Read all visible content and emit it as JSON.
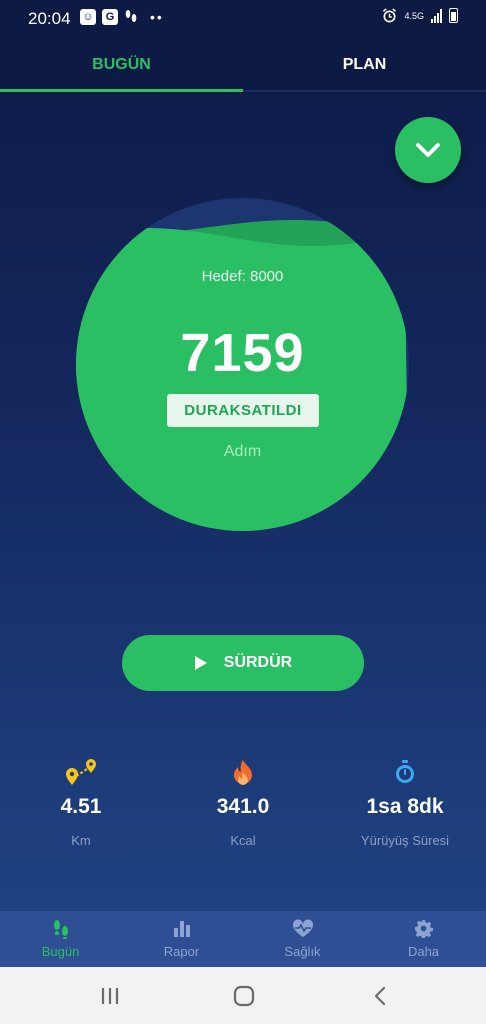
{
  "status_bar": {
    "time": "20:04",
    "network": "4.5G"
  },
  "tabs": [
    {
      "label": "BUGÜN"
    },
    {
      "label": "PLAN"
    }
  ],
  "today": {
    "goal": "Hedef: 8000",
    "steps": "7159",
    "goal_progress": 0.895,
    "state": "DURAKSATILDI",
    "unit": "Adım"
  },
  "resume_button": {
    "label": "SÜRDÜR"
  },
  "stats": [
    {
      "icon": "location-route-icon",
      "value": "4.51",
      "label": "Km"
    },
    {
      "icon": "fire-icon",
      "value": "341.0",
      "label": "Kcal"
    },
    {
      "icon": "stopwatch-icon",
      "value": "1sa 8dk",
      "label": "Yürüyüş Süresi"
    }
  ],
  "bottom_nav": [
    {
      "icon": "footsteps-icon",
      "label": "Bugün",
      "active": true
    },
    {
      "icon": "bar-chart-icon",
      "label": "Rapor",
      "active": false
    },
    {
      "icon": "heart-pulse-icon",
      "label": "Sağlık",
      "active": false
    },
    {
      "icon": "gear-icon",
      "label": "Daha",
      "active": false
    }
  ],
  "colors": {
    "accent": "#2bbf63",
    "background": "#13255a",
    "nav_bar": "#2e4f94"
  }
}
